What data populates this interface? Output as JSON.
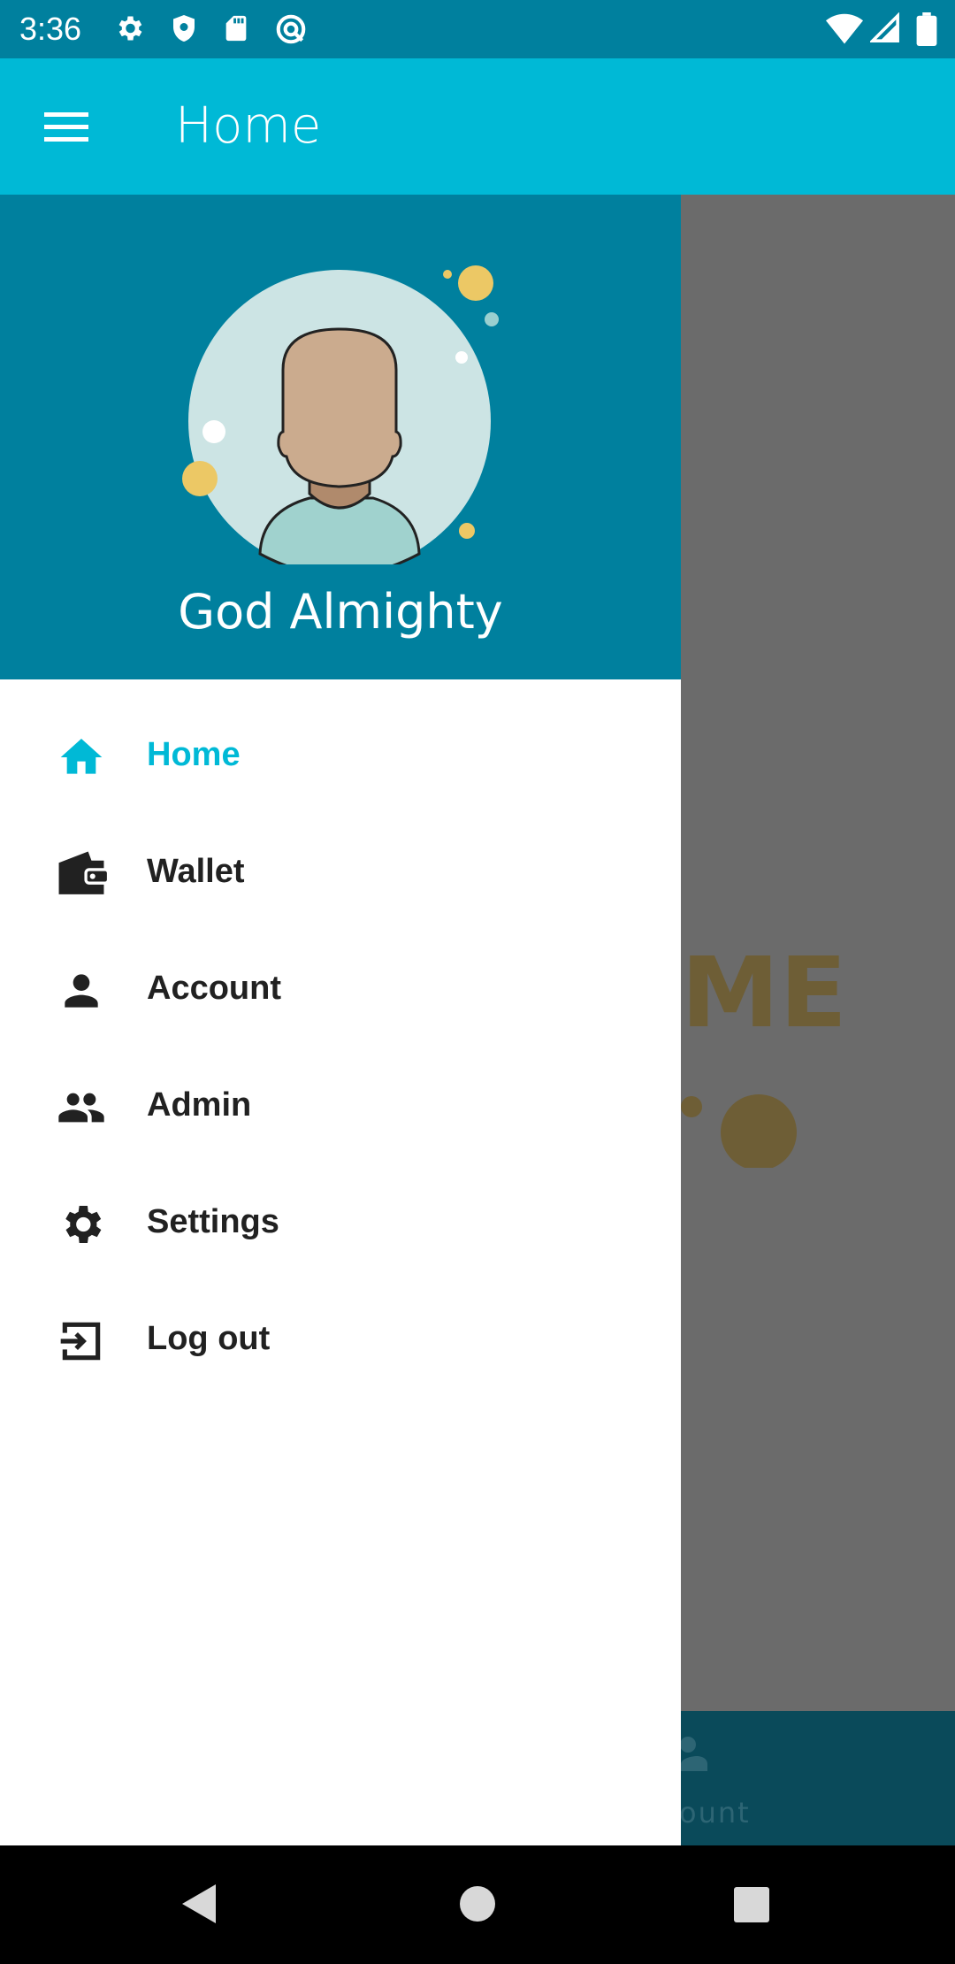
{
  "status_bar": {
    "time": "3:36",
    "icons_left": [
      "settings-icon",
      "shield-icon",
      "sd-card-icon",
      "sync-icon"
    ],
    "icons_right": [
      "wifi-icon",
      "signal-icon",
      "battery-icon"
    ]
  },
  "app_bar": {
    "title": "Home",
    "menu_icon": "hamburger-menu-icon",
    "background": "#00b9d6"
  },
  "drawer": {
    "header_background": "#00809e",
    "user_name": "God Almighty",
    "items": [
      {
        "label": "Home",
        "icon": "home-icon",
        "active": true
      },
      {
        "label": "Wallet",
        "icon": "wallet-icon",
        "active": false
      },
      {
        "label": "Account",
        "icon": "person-icon",
        "active": false
      },
      {
        "label": "Admin",
        "icon": "people-icon",
        "active": false
      },
      {
        "label": "Settings",
        "icon": "gear-icon",
        "active": false
      },
      {
        "label": "Log out",
        "icon": "logout-icon",
        "active": false
      }
    ],
    "active_color": "#00b9d6"
  },
  "background_content": {
    "welcome_partial": "ME",
    "bottom_nav_partial_label": "ount"
  },
  "system_nav": {
    "buttons": [
      "back-button",
      "home-button",
      "recents-button"
    ]
  }
}
